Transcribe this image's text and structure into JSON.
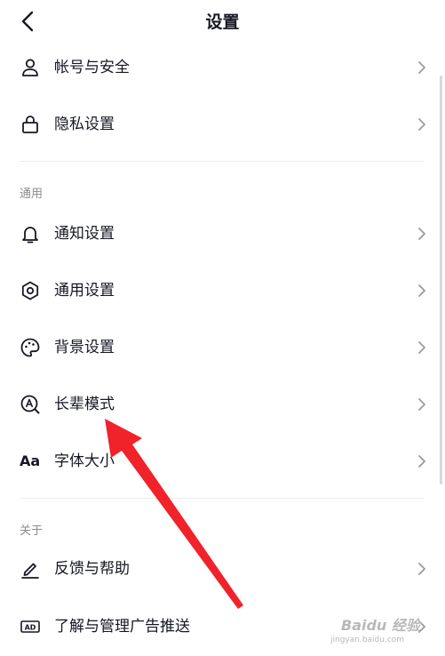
{
  "header": {
    "title": "设置"
  },
  "account": [
    {
      "label": "帐号与安全",
      "icon": "user-icon"
    },
    {
      "label": "隐私设置",
      "icon": "lock-icon"
    }
  ],
  "general": {
    "title": "通用",
    "items": [
      {
        "label": "通知设置",
        "icon": "bell-icon"
      },
      {
        "label": "通用设置",
        "icon": "gear-icon"
      },
      {
        "label": "背景设置",
        "icon": "palette-icon"
      },
      {
        "label": "长辈模式",
        "icon": "elder-mode-icon"
      },
      {
        "label": "字体大小",
        "icon": "font-size-icon",
        "icon_text": "Aa"
      }
    ]
  },
  "about": {
    "title": "关于",
    "items": [
      {
        "label": "反馈与帮助",
        "icon": "pen-icon"
      },
      {
        "label": "了解与管理广告推送",
        "icon": "ad-icon",
        "icon_text": "AD"
      }
    ]
  },
  "watermark": {
    "main": "Baidu 经验",
    "sub": "jingyan.baidu.com"
  },
  "colors": {
    "annotation_arrow": "#f0222a",
    "text": "#161823",
    "secondary": "#8a8b91"
  }
}
